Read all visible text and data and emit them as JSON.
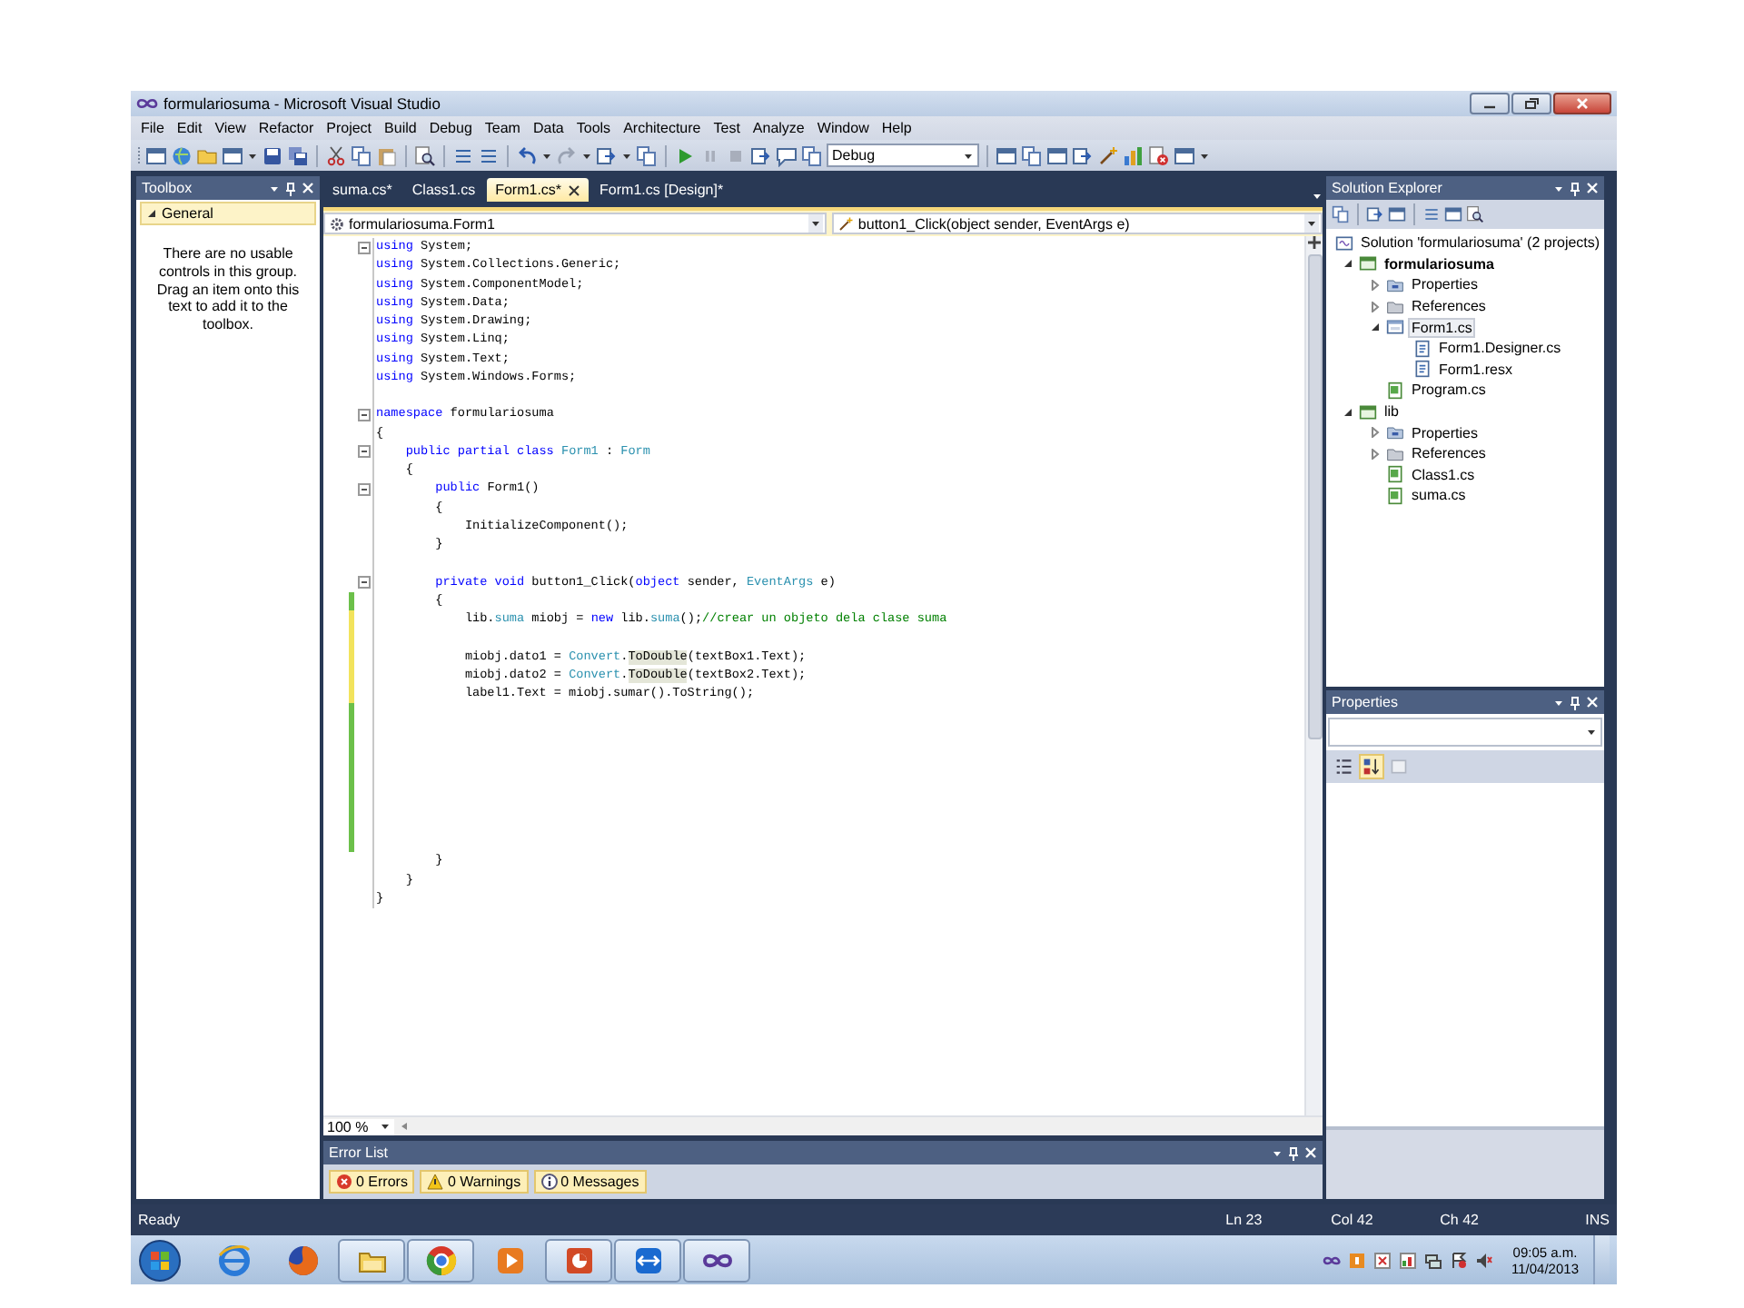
{
  "window": {
    "title": "formulariosuma - Microsoft Visual Studio"
  },
  "menu": [
    "File",
    "Edit",
    "View",
    "Refactor",
    "Project",
    "Build",
    "Debug",
    "Team",
    "Data",
    "Tools",
    "Architecture",
    "Test",
    "Analyze",
    "Window",
    "Help"
  ],
  "toolbar": {
    "configuration": "Debug"
  },
  "toolbox": {
    "title": "Toolbox",
    "group": {
      "label": "General",
      "expanded": true
    },
    "message": "There are no usable controls in this group. Drag an item onto this text to add it to the toolbox."
  },
  "tabs": [
    {
      "label": "suma.cs*",
      "selected": false
    },
    {
      "label": "Class1.cs",
      "selected": false
    },
    {
      "label": "Form1.cs*",
      "selected": true
    },
    {
      "label": "Form1.cs [Design]*",
      "selected": false
    }
  ],
  "navigation": {
    "type": "formulariosuma.Form1",
    "member": "button1_Click(object sender, EventArgs e)"
  },
  "code": [
    {
      "fold": true,
      "changed": false,
      "tokens": [
        {
          "kind": "kw",
          "text": "using"
        },
        {
          "kind": "plain",
          "text": " System;"
        }
      ]
    },
    {
      "fold": false,
      "changed": false,
      "tokens": [
        {
          "kind": "kw",
          "text": "using"
        },
        {
          "kind": "plain",
          "text": " System.Collections.Generic;"
        }
      ]
    },
    {
      "fold": false,
      "changed": false,
      "tokens": [
        {
          "kind": "kw",
          "text": "using"
        },
        {
          "kind": "plain",
          "text": " System.ComponentModel;"
        }
      ]
    },
    {
      "fold": false,
      "changed": false,
      "tokens": [
        {
          "kind": "kw",
          "text": "using"
        },
        {
          "kind": "plain",
          "text": " System.Data;"
        }
      ]
    },
    {
      "fold": false,
      "changed": false,
      "tokens": [
        {
          "kind": "kw",
          "text": "using"
        },
        {
          "kind": "plain",
          "text": " System.Drawing;"
        }
      ]
    },
    {
      "fold": false,
      "changed": false,
      "tokens": [
        {
          "kind": "kw",
          "text": "using"
        },
        {
          "kind": "plain",
          "text": " System.Linq;"
        }
      ]
    },
    {
      "fold": false,
      "changed": false,
      "tokens": [
        {
          "kind": "kw",
          "text": "using"
        },
        {
          "kind": "plain",
          "text": " System.Text;"
        }
      ]
    },
    {
      "fold": false,
      "changed": false,
      "tokens": [
        {
          "kind": "kw",
          "text": "using"
        },
        {
          "kind": "plain",
          "text": " System.Windows.Forms;"
        }
      ]
    },
    {
      "fold": false,
      "changed": false
    },
    {
      "fold": true,
      "changed": false,
      "tokens": [
        {
          "kind": "kw",
          "text": "namespace"
        },
        {
          "kind": "plain",
          "text": " formulariosuma"
        }
      ]
    },
    {
      "fold": false,
      "changed": false,
      "tokens": [
        {
          "kind": "plain",
          "text": "{"
        }
      ]
    },
    {
      "fold": true,
      "changed": false,
      "tokens": [
        {
          "kind": "kw",
          "text": "    public partial class"
        },
        {
          "kind": "type",
          "text": " Form1"
        },
        {
          "kind": "plain",
          "text": " : "
        },
        {
          "kind": "type",
          "text": "Form"
        }
      ]
    },
    {
      "fold": false,
      "changed": false,
      "tokens": [
        {
          "kind": "plain",
          "text": "    {"
        }
      ]
    },
    {
      "fold": true,
      "changed": false,
      "tokens": [
        {
          "kind": "kw",
          "text": "        public"
        },
        {
          "kind": "plain",
          "text": " Form1()"
        }
      ]
    },
    {
      "fold": false,
      "changed": false,
      "tokens": [
        {
          "kind": "plain",
          "text": "        {"
        }
      ]
    },
    {
      "fold": false,
      "changed": false,
      "tokens": [
        {
          "kind": "plain",
          "text": "            InitializeComponent();"
        }
      ]
    },
    {
      "fold": false,
      "changed": false,
      "tokens": [
        {
          "kind": "plain",
          "text": "        }"
        }
      ]
    },
    {
      "fold": false,
      "changed": false
    },
    {
      "fold": true,
      "changed": false,
      "tokens": [
        {
          "kind": "kw",
          "text": "        private void"
        },
        {
          "kind": "plain",
          "text": " button1_Click("
        },
        {
          "kind": "kw",
          "text": "object"
        },
        {
          "kind": "plain",
          "text": " sender, "
        },
        {
          "kind": "type",
          "text": "EventArgs"
        },
        {
          "kind": "plain",
          "text": " e)"
        }
      ]
    },
    {
      "fold": false,
      "changed": true,
      "saved": true,
      "tokens": [
        {
          "kind": "plain",
          "text": "        {"
        }
      ]
    },
    {
      "fold": false,
      "changed": true,
      "saved": false,
      "tokens": [
        {
          "kind": "plain",
          "text": "            lib."
        },
        {
          "kind": "type",
          "text": "suma"
        },
        {
          "kind": "plain",
          "text": " miobj = "
        },
        {
          "kind": "kw",
          "text": "new"
        },
        {
          "kind": "plain",
          "text": " lib."
        },
        {
          "kind": "type",
          "text": "suma"
        },
        {
          "kind": "plain",
          "text": "();"
        },
        {
          "kind": "comment",
          "text": "//crear un objeto dela clase suma"
        }
      ]
    },
    {
      "fold": false,
      "changed": true,
      "saved": false
    },
    {
      "fold": false,
      "changed": true,
      "saved": false,
      "tokens": [
        {
          "kind": "plain",
          "text": "            miobj.dato1 = "
        },
        {
          "kind": "type",
          "text": "Convert"
        },
        {
          "kind": "plain",
          "text": "."
        },
        {
          "kind": "ref",
          "text": "ToDouble"
        },
        {
          "kind": "plain",
          "text": "(textBox1.Text);"
        }
      ]
    },
    {
      "fold": false,
      "changed": true,
      "saved": false,
      "tokens": [
        {
          "kind": "plain",
          "text": "            miobj.dato2 = "
        },
        {
          "kind": "type",
          "text": "Convert"
        },
        {
          "kind": "plain",
          "text": "."
        },
        {
          "kind": "ref",
          "text": "ToDouble"
        },
        {
          "kind": "plain",
          "text": "(textBox2.Text);"
        }
      ]
    },
    {
      "fold": false,
      "changed": true,
      "saved": false,
      "tokens": [
        {
          "kind": "plain",
          "text": "            label1.Text = miobj.sumar().ToString();"
        }
      ]
    },
    {
      "fold": false,
      "changed": true,
      "saved": true
    },
    {
      "fold": false,
      "changed": true,
      "saved": true
    },
    {
      "fold": false,
      "changed": true,
      "saved": true
    },
    {
      "fold": false,
      "changed": true,
      "saved": true
    },
    {
      "fold": false,
      "changed": true,
      "saved": true
    },
    {
      "fold": false,
      "changed": true,
      "saved": true
    },
    {
      "fold": false,
      "changed": true,
      "saved": true
    },
    {
      "fold": false,
      "changed": true,
      "saved": true
    },
    {
      "fold": false,
      "changed": false,
      "tokens": [
        {
          "kind": "plain",
          "text": "        }"
        }
      ]
    },
    {
      "fold": false,
      "changed": false,
      "tokens": [
        {
          "kind": "plain",
          "text": "    }"
        }
      ]
    },
    {
      "fold": false,
      "changed": false,
      "tokens": [
        {
          "kind": "plain",
          "text": "}"
        }
      ]
    }
  ],
  "zoom": "100 %",
  "error_list": {
    "title": "Error List",
    "filters": [
      {
        "kind": "error",
        "label": "0 Errors",
        "selected": true
      },
      {
        "kind": "warning",
        "label": "0 Warnings",
        "selected": true
      },
      {
        "kind": "info",
        "label": "0 Messages",
        "selected": true
      }
    ]
  },
  "solution_explorer": {
    "title": "Solution Explorer",
    "tree": [
      {
        "kind": "solution",
        "label": "Solution 'formulariosuma' (2 projects)",
        "bold": false,
        "selected": false,
        "children": [
          {
            "kind": "project",
            "label": "formulariosuma",
            "expanded": true,
            "bold": true,
            "selected": false,
            "children": [
              {
                "kind": "properties",
                "label": "Properties",
                "expanded": false,
                "bold": false,
                "selected": false
              },
              {
                "kind": "references",
                "label": "References",
                "expanded": false,
                "bold": false,
                "selected": false
              },
              {
                "kind": "form",
                "label": "Form1.cs",
                "expanded": true,
                "bold": false,
                "selected": true,
                "children": [
                  {
                    "kind": "subfile",
                    "label": "Form1.Designer.cs",
                    "bold": false,
                    "selected": false
                  },
                  {
                    "kind": "subfile",
                    "label": "Form1.resx",
                    "bold": false,
                    "selected": false
                  }
                ]
              },
              {
                "kind": "code",
                "label": "Program.cs",
                "bold": false,
                "selected": false
              }
            ]
          },
          {
            "kind": "project",
            "label": "lib",
            "expanded": true,
            "bold": false,
            "selected": false,
            "children": [
              {
                "kind": "properties",
                "label": "Properties",
                "expanded": false,
                "bold": false,
                "selected": false
              },
              {
                "kind": "references",
                "label": "References",
                "expanded": false,
                "bold": false,
                "selected": false
              },
              {
                "kind": "code",
                "label": "Class1.cs",
                "bold": false,
                "selected": false
              },
              {
                "kind": "code",
                "label": "suma.cs",
                "bold": false,
                "selected": false
              }
            ]
          }
        ]
      }
    ]
  },
  "properties": {
    "title": "Properties",
    "buttons": [
      {
        "kind": "categorized",
        "selected": false
      },
      {
        "kind": "alphabetical",
        "selected": true
      },
      {
        "kind": "pages",
        "selected": false
      }
    ]
  },
  "status_bar": {
    "message": "Ready",
    "line": "Ln 23",
    "column": "Col 42",
    "char": "Ch 42",
    "mode": "INS"
  },
  "taskbar": {
    "apps": [
      {
        "running": false
      },
      {
        "running": false
      },
      {
        "running": true
      },
      {
        "running": true
      },
      {
        "running": false
      },
      {
        "running": true
      },
      {
        "running": true
      },
      {
        "running": true
      }
    ],
    "time": "09:05 a.m.",
    "date": "11/04/2013"
  }
}
